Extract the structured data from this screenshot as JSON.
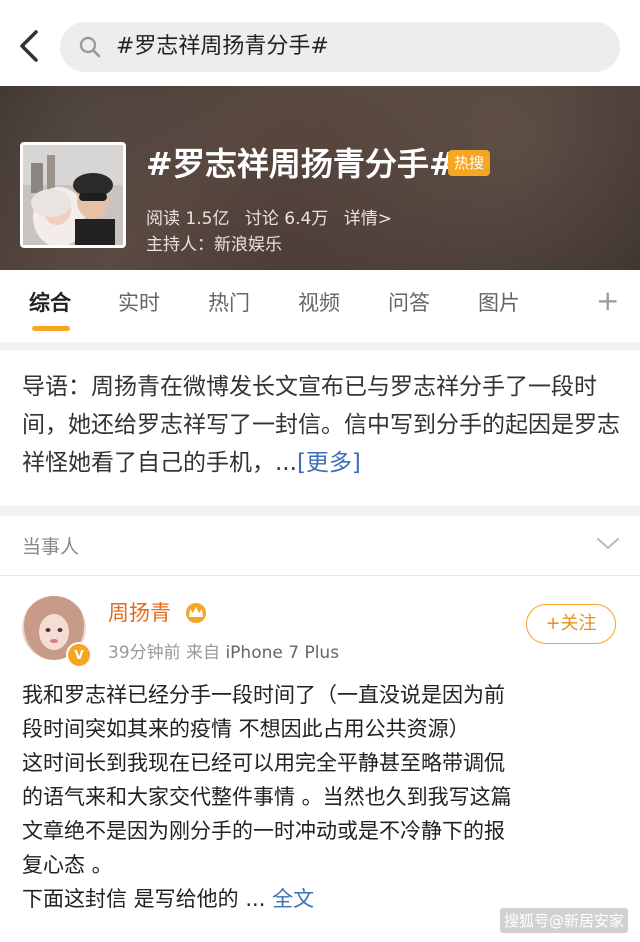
{
  "search": {
    "query": "#罗志祥周扬青分手#"
  },
  "topic": {
    "title": "#罗志祥周扬青分手#",
    "badge": "热搜",
    "reads": "阅读 1.5亿",
    "discussions": "讨论 6.4万",
    "details": "详情>",
    "host": "主持人：新浪娱乐"
  },
  "tabs": [
    {
      "label": "综合",
      "active": true
    },
    {
      "label": "实时"
    },
    {
      "label": "热门"
    },
    {
      "label": "视频"
    },
    {
      "label": "问答"
    },
    {
      "label": "图片"
    }
  ],
  "tab_add": "+",
  "intro": {
    "text": "导语：周扬青在微博发长文宣布已与罗志祥分手了一段时间，她还给罗志祥写了一封信。信中写到分手的起因是罗志祥怪她看了自己的手机，...",
    "more": "[更多]"
  },
  "section": {
    "label": "当事人"
  },
  "post": {
    "username": "周扬青",
    "time": "39分钟前",
    "source_prefix": "来自",
    "device": "iPhone 7 Plus",
    "follow_label": "+关注",
    "lines": [
      "我和罗志祥已经分手一段时间了（一直没说是因为前",
      "段时间突如其来的疫情 不想因此占用公共资源）",
      "这时间长到我现在已经可以用完全平静甚至略带调侃",
      "的语气来和大家交代整件事情 。当然也久到我写这篇",
      "文章绝不是因为刚分手的一时冲动或是不冷静下的报",
      "复心态 。"
    ],
    "last_line": "下面这封信 是写给他的 ...",
    "full_text": "全文"
  },
  "watermark": "搜狐号@新居安家",
  "colors": {
    "accent_orange": "#f5a623",
    "link_blue": "#3b6fb6",
    "username_orange": "#e46b1c"
  }
}
